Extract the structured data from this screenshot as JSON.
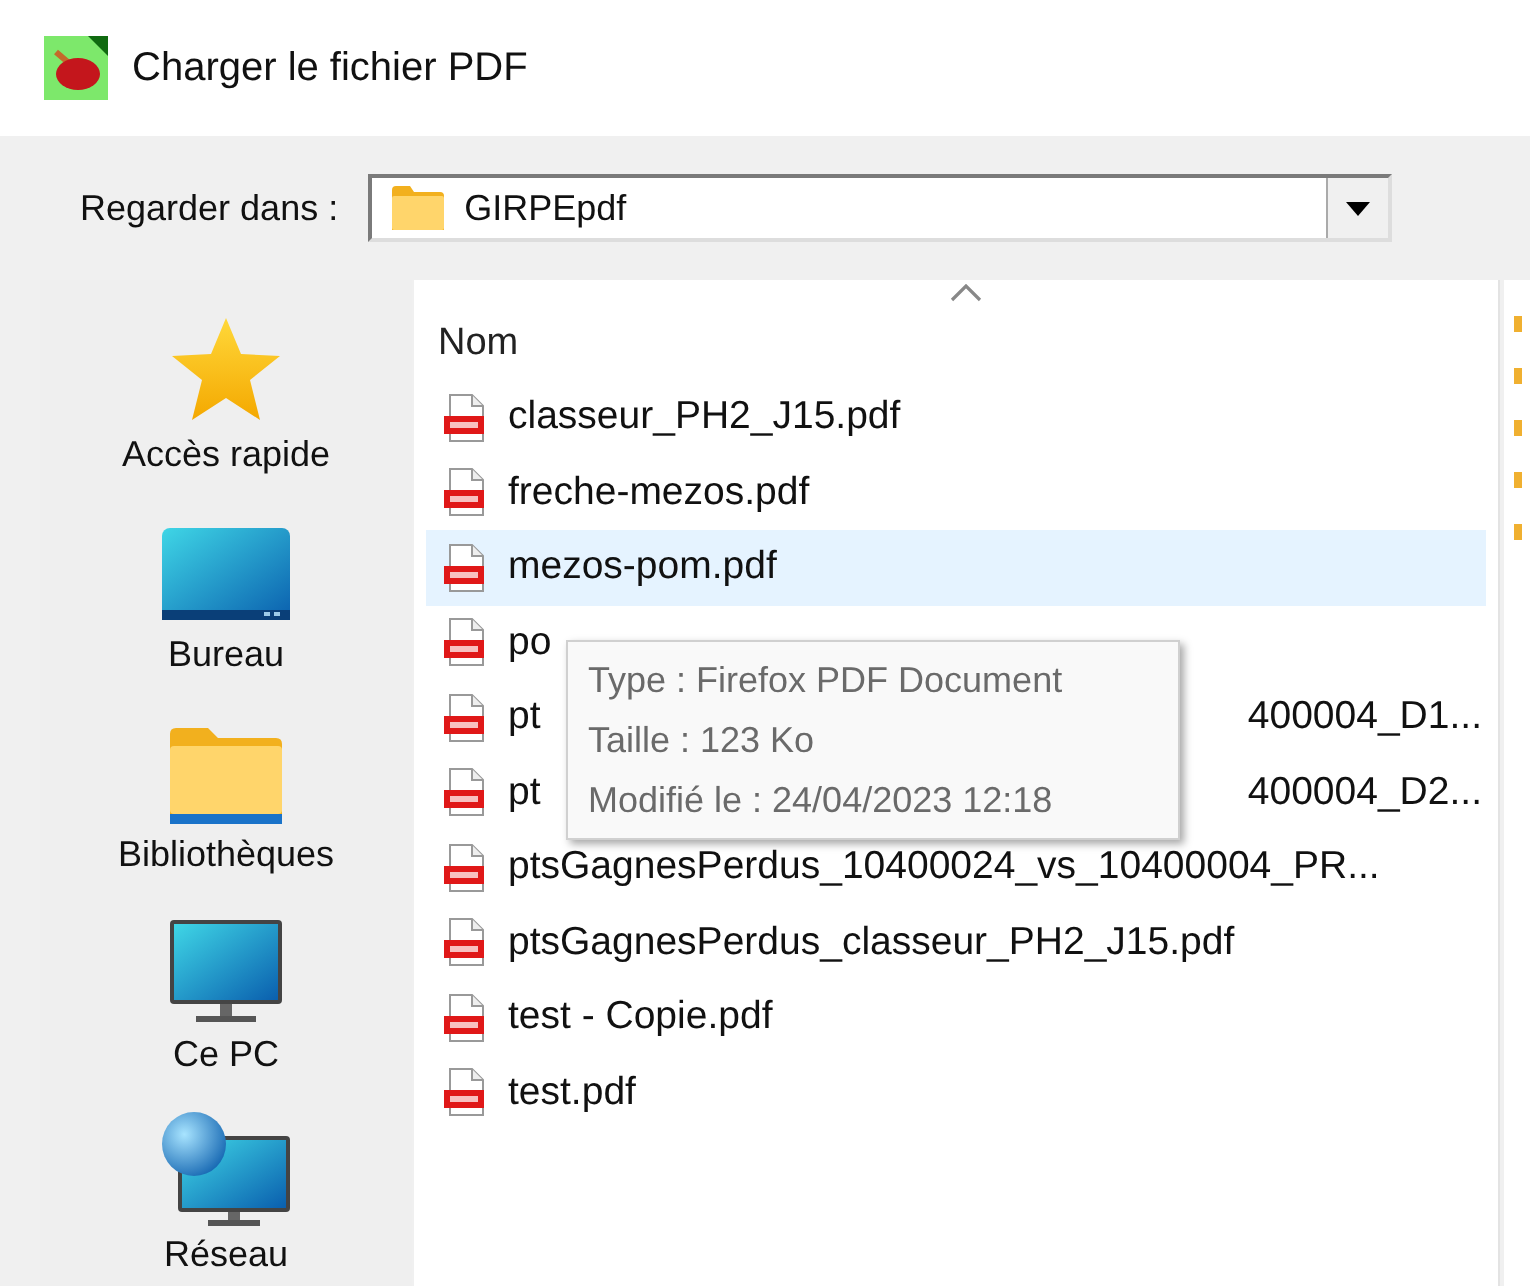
{
  "window": {
    "title": "Charger le fichier PDF"
  },
  "look_in": {
    "label": "Regarder dans :",
    "value": "GIRPEpdf"
  },
  "places": [
    {
      "label": "Accès rapide",
      "kind": "star"
    },
    {
      "label": "Bureau",
      "kind": "desktop"
    },
    {
      "label": "Bibliothèques",
      "kind": "folder"
    },
    {
      "label": "Ce PC",
      "kind": "computer"
    },
    {
      "label": "Réseau",
      "kind": "network"
    }
  ],
  "file_list": {
    "column": "Nom",
    "sort_ascending": true,
    "files": [
      {
        "name": "classeur_PH2_J15.pdf",
        "hovered": false
      },
      {
        "name": "freche-mezos.pdf",
        "hovered": false
      },
      {
        "name": "mezos-pom.pdf",
        "hovered": true
      },
      {
        "name": "po",
        "hovered": false
      },
      {
        "name": "pt",
        "tail": "400004_D1...",
        "hovered": false
      },
      {
        "name": "pt",
        "tail": "400004_D2...",
        "hovered": false
      },
      {
        "name": "ptsGagnesPerdus_10400024_vs_10400004_PR...",
        "hovered": false
      },
      {
        "name": "ptsGagnesPerdus_classeur_PH2_J15.pdf",
        "hovered": false
      },
      {
        "name": "test - Copie.pdf",
        "hovered": false
      },
      {
        "name": "test.pdf",
        "hovered": false
      }
    ]
  },
  "tooltip": {
    "lines": [
      "Type : Firefox PDF Document",
      "Taille : 123 Ko",
      "Modifié le : 24/04/2023 12:18"
    ]
  }
}
